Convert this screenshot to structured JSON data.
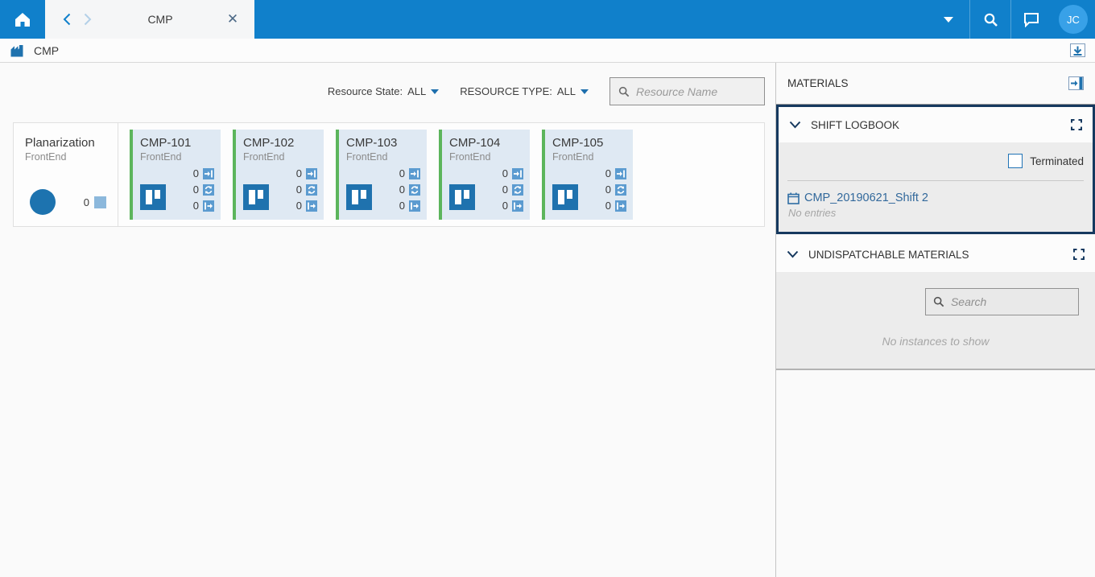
{
  "topbar": {
    "tab_title": "CMP",
    "avatar_initials": "JC"
  },
  "breadcrumb": {
    "label": "CMP"
  },
  "filters": {
    "resource_state_label": "Resource State:",
    "resource_state_value": "ALL",
    "resource_type_label": "RESOURCE TYPE:",
    "resource_type_value": "ALL",
    "search_placeholder": "Resource Name"
  },
  "resources": {
    "group": {
      "name": "Planarization",
      "area": "FrontEnd",
      "count": "0"
    },
    "machines": [
      {
        "name": "CMP-101",
        "area": "FrontEnd",
        "in": "0",
        "processing": "0",
        "out": "0"
      },
      {
        "name": "CMP-102",
        "area": "FrontEnd",
        "in": "0",
        "processing": "0",
        "out": "0"
      },
      {
        "name": "CMP-103",
        "area": "FrontEnd",
        "in": "0",
        "processing": "0",
        "out": "0"
      },
      {
        "name": "CMP-104",
        "area": "FrontEnd",
        "in": "0",
        "processing": "0",
        "out": "0"
      },
      {
        "name": "CMP-105",
        "area": "FrontEnd",
        "in": "0",
        "processing": "0",
        "out": "0"
      }
    ]
  },
  "sidebar": {
    "title": "MATERIALS",
    "shift_logbook": {
      "title": "SHIFT LOGBOOK",
      "terminated_label": "Terminated",
      "entry_name": "CMP_20190621_Shift 2",
      "entry_status": "No entries"
    },
    "undispatchable": {
      "title": "UNDISPATCHABLE MATERIALS",
      "search_placeholder": "Search",
      "empty_text": "No instances to show"
    }
  },
  "colors": {
    "brand_blue": "#1080cb",
    "avatar_blue": "#38a1e8",
    "card_bg_blue": "#dfe9f3",
    "status_green": "#5cb55c",
    "icon_blue": "#1f72ae",
    "count_icon_blue": "#5b9bd0",
    "link_blue": "#31689b",
    "selected_border_navy": "#16395f"
  }
}
